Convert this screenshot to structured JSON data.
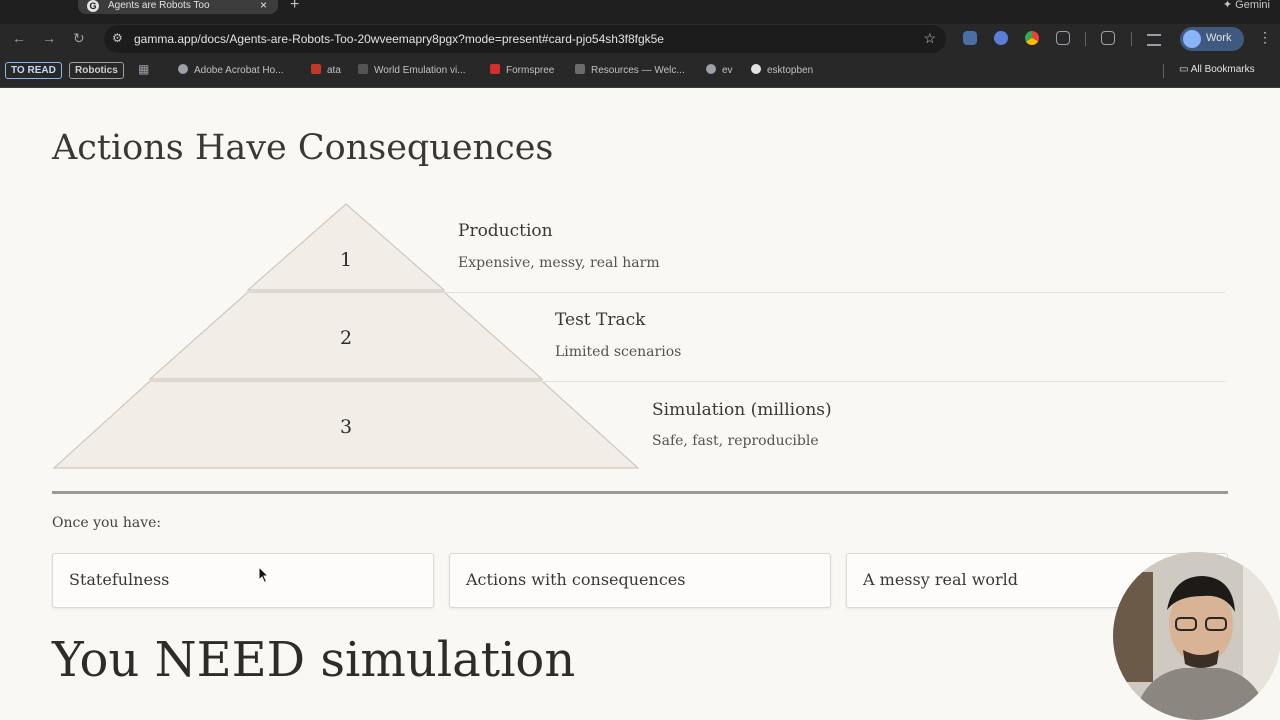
{
  "browser": {
    "tab_title": "Agents are Robots Too",
    "tab_favicon": "G",
    "url": "gamma.app/docs/Agents-are-Robots-Too-20wveemapry8pgx?mode=present#card-pjo54sh3f8fgk5e",
    "profile_label": "Work",
    "gemini_label": "Gemini",
    "bookmarks": [
      "TO READ",
      "Robotics",
      "Adobe Acrobat Ho...",
      "ata",
      "World Emulation vi...",
      "Formspree",
      "Resources — Welc...",
      "ev",
      "esktopben"
    ],
    "all_bookmarks_label": "All Bookmarks"
  },
  "slide": {
    "title": "Actions Have Consequences",
    "pyramid": [
      {
        "number": "1",
        "title": "Production",
        "desc": "Expensive, messy, real harm"
      },
      {
        "number": "2",
        "title": "Test Track",
        "desc": "Limited scenarios"
      },
      {
        "number": "3",
        "title": "Simulation (millions)",
        "desc": "Safe, fast, reproducible"
      }
    ],
    "once_label": "Once you have:",
    "cards": [
      "Statefulness",
      "Actions with consequences",
      "A messy real world"
    ],
    "next_title": "You NEED simulation"
  },
  "colors": {
    "pyramid_fill": "#f2ede7",
    "pyramid_stroke": "#cfc8bc",
    "page_bg": "#faf8f5",
    "text": "#3a3835"
  }
}
